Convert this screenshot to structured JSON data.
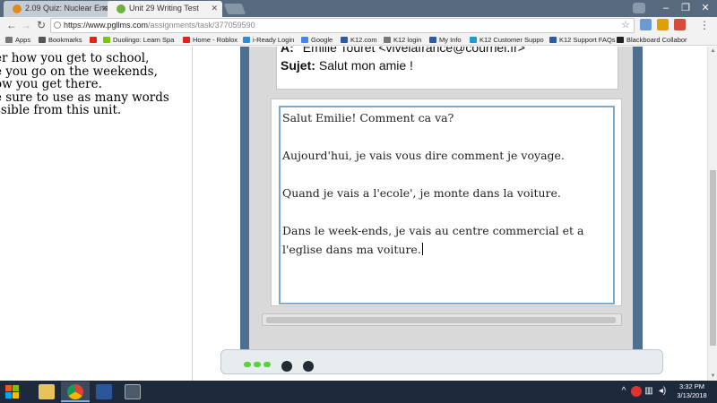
{
  "browser": {
    "tabs": [
      {
        "title": "2.09 Quiz: Nuclear Energ",
        "active": false,
        "favicon_color": "#e28a1d"
      },
      {
        "title": "Unit 29 Writing Test",
        "active": true,
        "favicon_color": "#6bb23b"
      }
    ],
    "url_host": "https://www.pgllms.com",
    "url_path": "/assignments/task/377059590",
    "bookmarks": [
      {
        "label": "Apps",
        "icon": "apps-grid-icon",
        "color": "#666"
      },
      {
        "label": "Bookmarks",
        "icon": "star-icon",
        "color": "#555"
      },
      {
        "label": "",
        "icon": "youtube-icon",
        "color": "#e62117"
      },
      {
        "label": "Duolingo: Learn Spa",
        "icon": "duolingo-icon",
        "color": "#78c800"
      },
      {
        "label": "Home - Roblox",
        "icon": "roblox-icon",
        "color": "#e2231a"
      },
      {
        "label": "i-Ready Login",
        "icon": "iready-icon",
        "color": "#2e8bd6"
      },
      {
        "label": "Google",
        "icon": "google-icon",
        "color": "#4285f4"
      },
      {
        "label": "K12.com",
        "icon": "k12-icon",
        "color": "#2d5aa8"
      },
      {
        "label": "K12 login",
        "icon": "page-icon",
        "color": "#777"
      },
      {
        "label": "My Info",
        "icon": "k12-icon",
        "color": "#2d5aa8"
      },
      {
        "label": "K12 Customer Suppo",
        "icon": "cloud-icon",
        "color": "#1e9ad6"
      },
      {
        "label": "K12 Support FAQs",
        "icon": "k12-icon",
        "color": "#2d5aa8"
      },
      {
        "label": "Blackboard Collabor",
        "icon": "blackboard-icon",
        "color": "#222"
      }
    ]
  },
  "instructions": {
    "lines": [
      "er how you get to school,",
      "e you go on the weekends,",
      "ow you get there.",
      "e sure to use as many words",
      "ssible from this unit."
    ]
  },
  "email": {
    "to_label": "A:",
    "to_value": "Emilie Touret  <vivelafrance@courriel.fr>",
    "subject_label": "Sujet:",
    "subject_value": "Salut mon amie !"
  },
  "editor": {
    "paragraphs": [
      "Salut Emilie! Comment ca va?",
      "Aujourd'hui,  je vais vous dire comment je voyage.",
      "Quand je vais a l'ecole', je monte dans la voiture.",
      "Dans le week-ends, je vais au centre commercial et a  l'eglise dans ma voiture."
    ]
  },
  "taskbar": {
    "time": "3:32 PM",
    "date": "3/13/2018"
  }
}
